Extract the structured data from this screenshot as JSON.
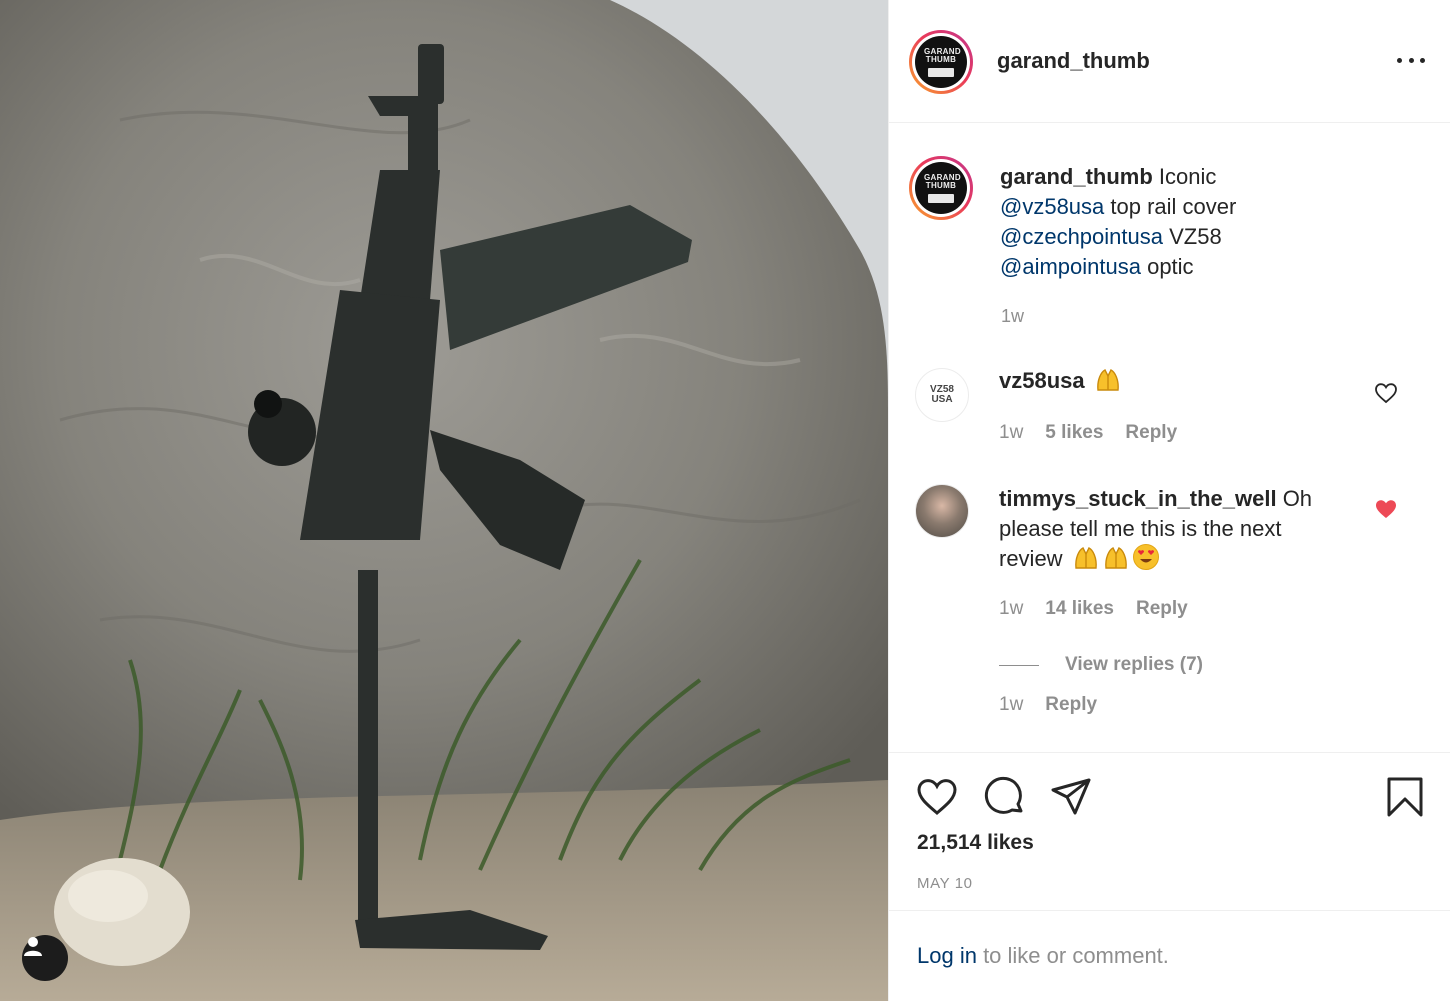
{
  "post": {
    "username": "garand_thumb",
    "avatar_text": "GARAND THUMB",
    "caption": {
      "username": "garand_thumb",
      "text_1": " Iconic",
      "mention_1": "@vz58usa",
      "text_2": " top rail cover",
      "mention_2": "@czechpointusa",
      "text_3": " VZ58",
      "mention_3": "@aimpointusa",
      "text_4": " optic",
      "time": "1w"
    },
    "likes": "21,514 likes",
    "date": "MAY 10"
  },
  "comments": [
    {
      "username": "vz58usa",
      "avatar_text": "VZ58 USA",
      "text": "",
      "emoji": [
        "raising-hands"
      ],
      "time": "1w",
      "likes": "5 likes",
      "reply_label": "Reply",
      "liked": false
    },
    {
      "username": "timmys_stuck_in_the_well",
      "text": " Oh please tell me this is the next review",
      "emoji": [
        "raising-hands",
        "raising-hands",
        "heart-eyes"
      ],
      "time": "1w",
      "likes": "14 likes",
      "reply_label": "Reply",
      "liked": true,
      "view_replies": "View replies (7)",
      "reply_time": "1w",
      "reply_reply_label": "Reply"
    }
  ],
  "footer": {
    "login_label": "Log in",
    "rest": " to like or comment."
  },
  "colors": {
    "story_ring_start": "#f9a52c",
    "story_ring_end": "#c0358e",
    "mention": "#00376b",
    "liked_heart": "#ed4956",
    "muted": "#8e8e8e"
  },
  "icons": [
    "user-tag-icon",
    "more-options-icon",
    "like-icon",
    "comment-icon",
    "share-icon",
    "save-icon",
    "comment-like-icon"
  ]
}
